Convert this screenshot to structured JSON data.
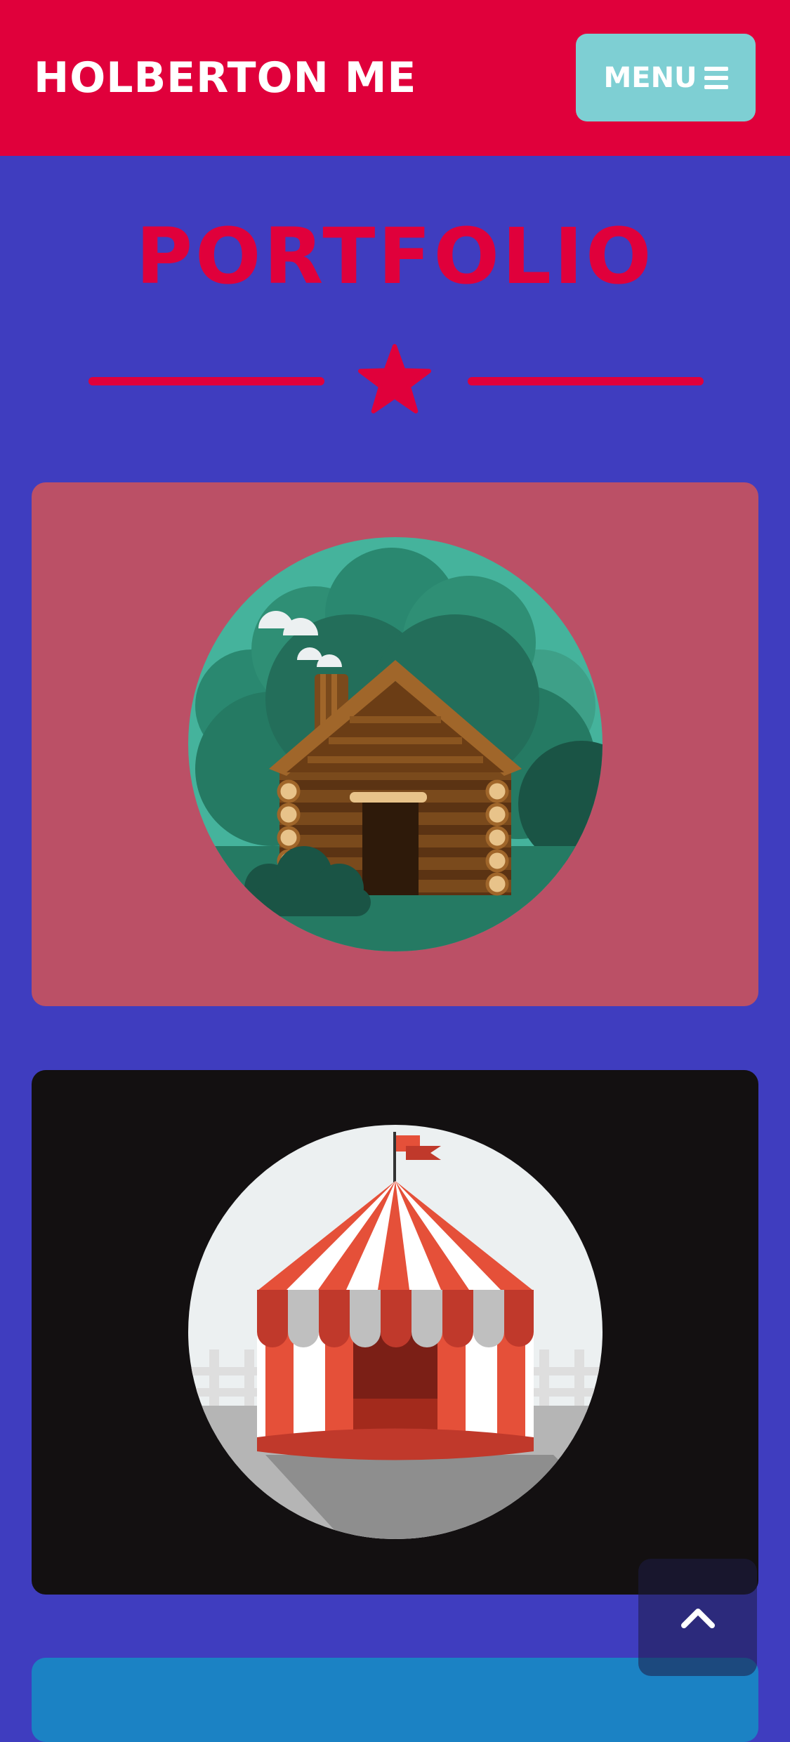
{
  "header": {
    "brand": "HOLBERTON ME",
    "menu_label": "MENU"
  },
  "section": {
    "title": "PORTFOLIO"
  },
  "portfolio": [
    {
      "image": "log-cabin-illustration",
      "background": "#bb5066"
    },
    {
      "image": "circus-tent-illustration",
      "background": "#131011"
    },
    {
      "image": "",
      "background": "#1b82c4"
    }
  ],
  "icons": {
    "menu": "hamburger-icon",
    "divider": "star-icon",
    "scroll": "chevron-up-icon"
  },
  "colors": {
    "primary": "#e0003b",
    "background": "#3f3dbf",
    "menu_button": "#7ecfd3"
  }
}
